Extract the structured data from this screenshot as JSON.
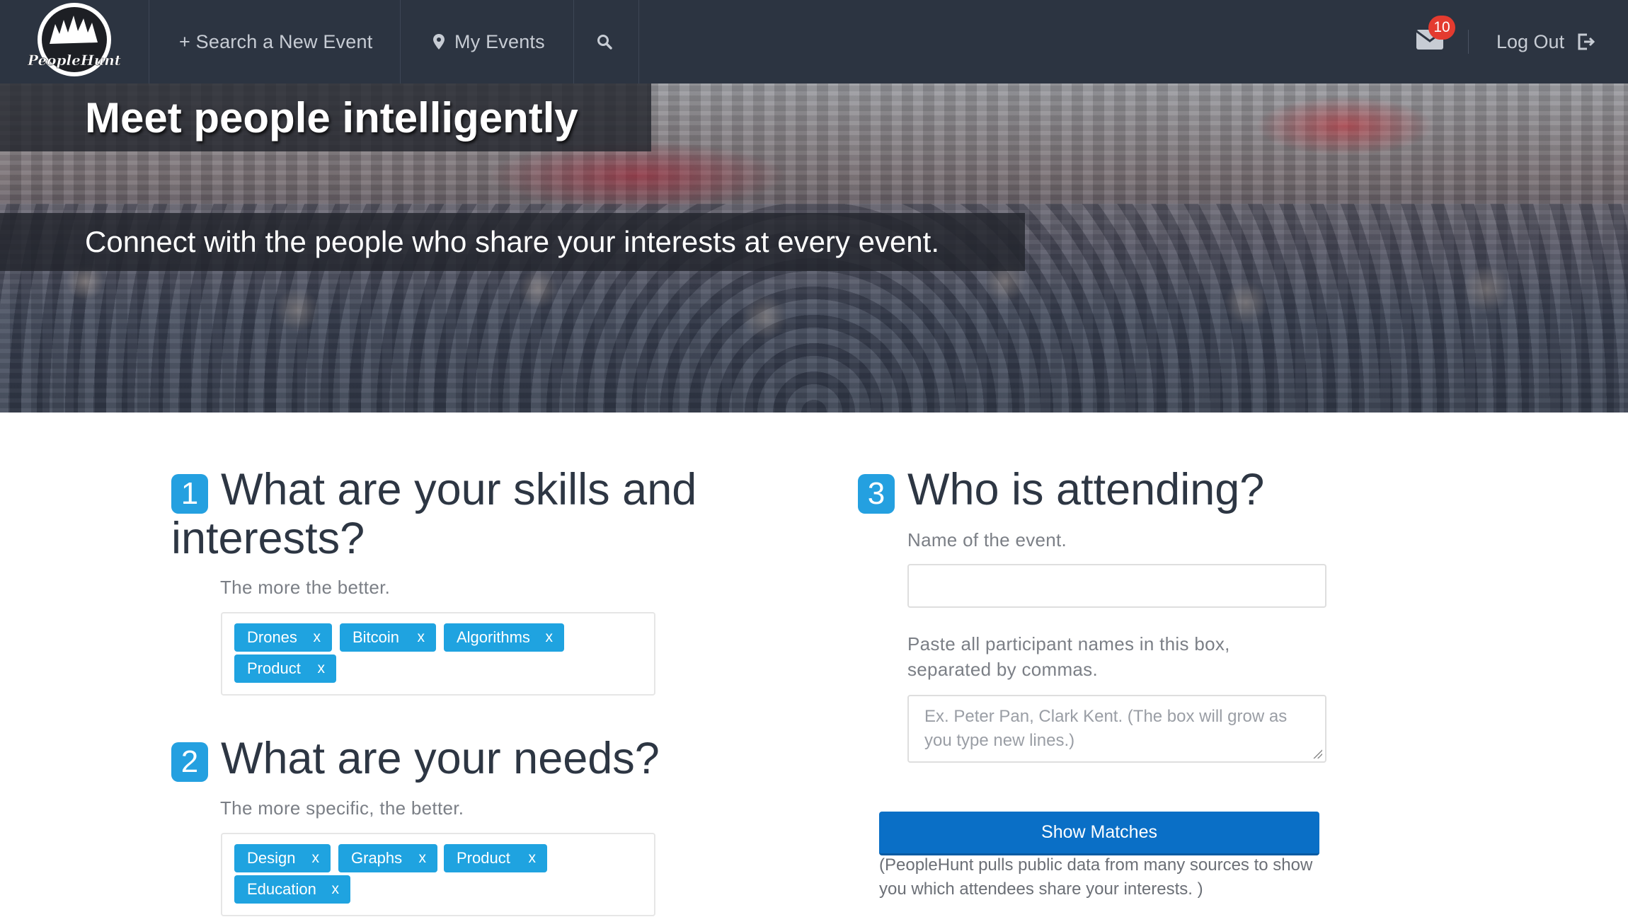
{
  "brand": {
    "logo_text": "PeopleHunt"
  },
  "nav": {
    "search_event": "+ Search a New Event",
    "my_events": "My Events",
    "mail_count": "10",
    "logout": "Log Out"
  },
  "hero": {
    "title": "Meet people intelligently",
    "subtitle": "Connect with the people who share your interests at every event."
  },
  "step1": {
    "number": "1",
    "heading_line1": "What are your skills and",
    "heading_line2": "interests?",
    "hint": "The more the better.",
    "tags": [
      "Drones",
      "Bitcoin",
      "Algorithms",
      "Product"
    ]
  },
  "step2": {
    "number": "2",
    "heading": "What are your needs?",
    "hint": "The more specific, the better.",
    "tags": [
      "Design",
      "Graphs",
      "Product",
      "Education"
    ]
  },
  "step3": {
    "number": "3",
    "heading": "Who is attending?",
    "event_label": "Name of the event.",
    "event_value": "",
    "participants_label_line1": "Paste all participant names in this box,",
    "participants_label_line2": "separated by commas.",
    "participants_placeholder_line1": "Ex. Peter Pan, Clark Kent. (The box will grow as",
    "participants_placeholder_line2": "you type new lines.)"
  },
  "actions": {
    "show_matches": "Show Matches",
    "note_line1": "(PeopleHunt pulls public data from many sources to show",
    "note_line2": "you which attendees share your interests. )",
    "tag_remove": "x"
  },
  "colors": {
    "nav_bg": "#2c3441",
    "accent": "#1fa3e0",
    "button": "#0a6fc6",
    "badge": "#e43b2f"
  }
}
